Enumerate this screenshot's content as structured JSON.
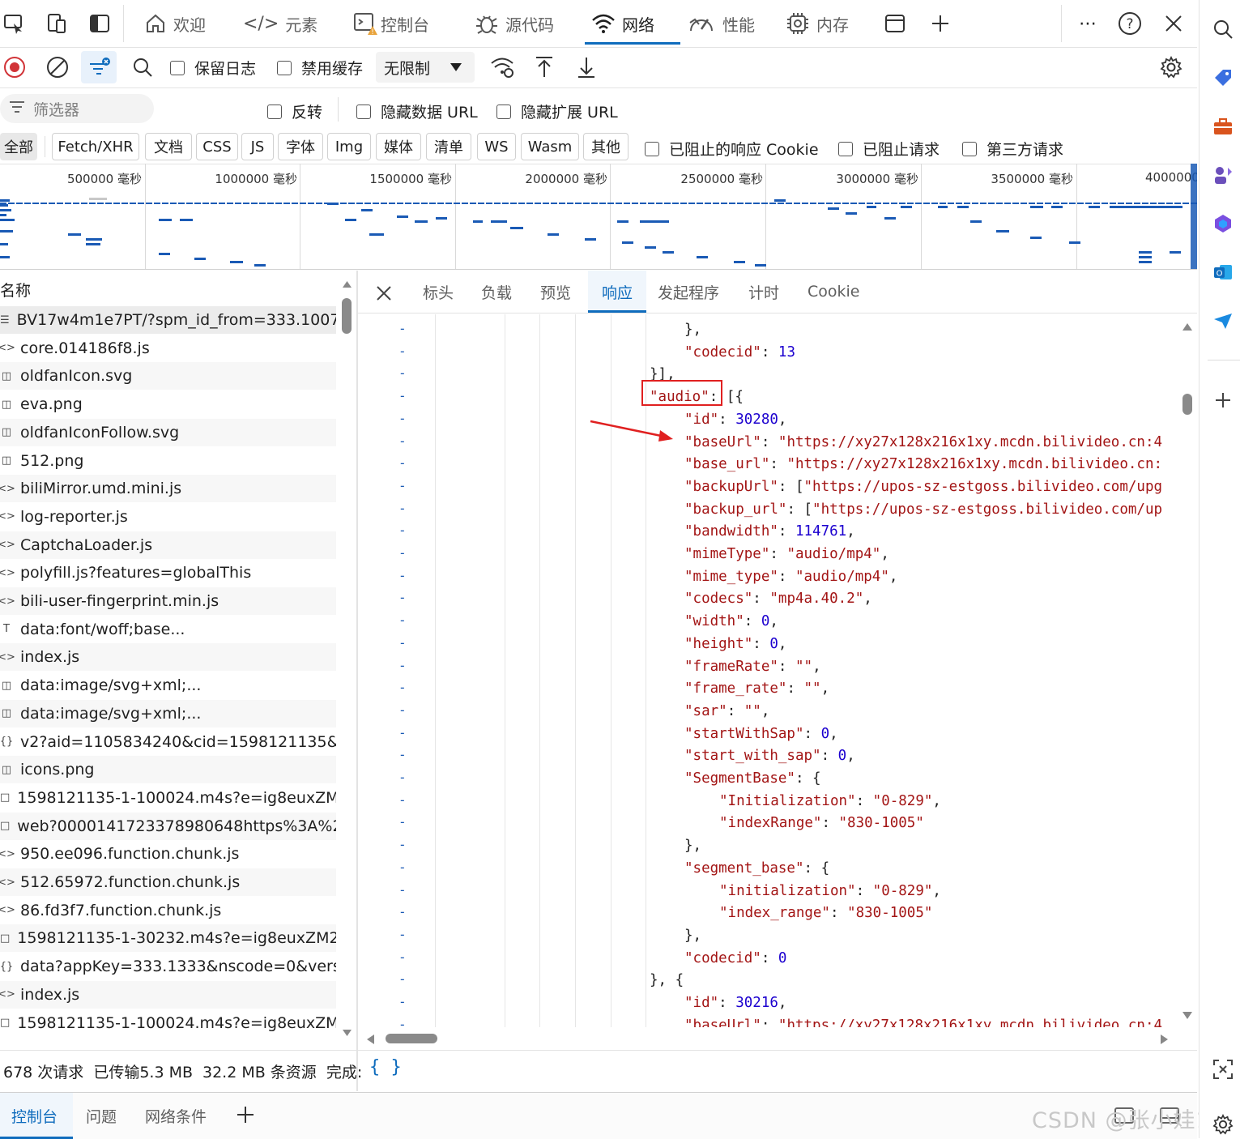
{
  "top_tabs": [
    {
      "label": "欢迎",
      "icon": "home-icon"
    },
    {
      "label": "元素",
      "icon": "code-brackets-icon"
    },
    {
      "label": "控制台",
      "icon": "console-icon"
    },
    {
      "label": "源代码",
      "icon": "bug-icon"
    },
    {
      "label": "网络",
      "icon": "wifi-icon"
    },
    {
      "label": "性能",
      "icon": "performance-icon"
    },
    {
      "label": "内存",
      "icon": "memory-chip-icon"
    }
  ],
  "toolbar": {
    "preserve_log": "保留日志",
    "disable_cache": "禁用缓存",
    "throttling": "无限制"
  },
  "filter": {
    "placeholder": "筛选器",
    "invert": "反转",
    "hide_data_urls": "隐藏数据 URL",
    "hide_ext_urls": "隐藏扩展 URL"
  },
  "type_filters": [
    "全部",
    "Fetch/XHR",
    "文档",
    "CSS",
    "JS",
    "字体",
    "Img",
    "媒体",
    "清单",
    "WS",
    "Wasm",
    "其他"
  ],
  "extra_filters": {
    "blocked_cookies": "已阻止的响应 Cookie",
    "blocked_requests": "已阻止请求",
    "third_party": "第三方请求"
  },
  "overview_ticks": [
    "500000 毫秒",
    "1000000 毫秒",
    "1500000 毫秒",
    "2000000 毫秒",
    "2500000 毫秒",
    "3000000 毫秒",
    "3500000 毫秒",
    "4000000"
  ],
  "list_header": "名称",
  "requests": [
    "BV17w4m1e7PT/?spm_id_from=333.1007....",
    "core.014186f8.js",
    "oldfanIcon.svg",
    "eva.png",
    "oldfanIconFollow.svg",
    "512.png",
    "biliMirror.umd.mini.js",
    "log-reporter.js",
    "CaptchaLoader.js",
    "polyfill.js?features=globalThis",
    "bili-user-fingerprint.min.js",
    "data:font/woff;base...",
    "index.js",
    "data:image/svg+xml;...",
    "data:image/svg+xml;...",
    "v2?aid=1105834240&cid=1598121135&is...",
    "icons.png",
    "1598121135-1-100024.m4s?e=ig8euxZM2...",
    "web?0000141723378980648https%3A%2F...",
    "950.ee096.function.chunk.js",
    "512.65972.function.chunk.js",
    "86.fd3f7.function.chunk.js",
    "1598121135-1-30232.m4s?e=ig8euxZM2r...",
    "data?appKey=333.1333&nscode=0&versi...",
    "index.js",
    "1598121135-1-100024.m4s?e=ig8euxZM2..."
  ],
  "detail_tabs": [
    "标头",
    "负载",
    "预览",
    "响应",
    "发起程序",
    "计时",
    "Cookie"
  ],
  "code_lines": [
    {
      "i": 2,
      "t": [
        [
          "p",
          "},"
        ]
      ]
    },
    {
      "i": 2,
      "t": [
        [
          "k",
          "\"codecid\""
        ],
        [
          "p",
          ": "
        ],
        [
          "n",
          "13"
        ]
      ]
    },
    {
      "i": 0,
      "t": [
        [
          "p",
          "}],"
        ]
      ]
    },
    {
      "i": 0,
      "t": [
        [
          "k",
          "\"audio\""
        ],
        [
          "p",
          ": [{"
        ]
      ]
    },
    {
      "i": 2,
      "t": [
        [
          "k",
          "\"id\""
        ],
        [
          "p",
          ": "
        ],
        [
          "n",
          "30280"
        ],
        [
          "p",
          ","
        ]
      ]
    },
    {
      "i": 2,
      "t": [
        [
          "k",
          "\"baseUrl\""
        ],
        [
          "p",
          ": "
        ],
        [
          "s",
          "\"https://xy27x128x216x1xy.mcdn.bilivideo.cn:4"
        ]
      ]
    },
    {
      "i": 2,
      "t": [
        [
          "k",
          "\"base_url\""
        ],
        [
          "p",
          ": "
        ],
        [
          "s",
          "\"https://xy27x128x216x1xy.mcdn.bilivideo.cn:"
        ]
      ]
    },
    {
      "i": 2,
      "t": [
        [
          "k",
          "\"backupUrl\""
        ],
        [
          "p",
          ": ["
        ],
        [
          "s",
          "\"https://upos-sz-estgoss.bilivideo.com/upg"
        ]
      ]
    },
    {
      "i": 2,
      "t": [
        [
          "k",
          "\"backup_url\""
        ],
        [
          "p",
          ": ["
        ],
        [
          "s",
          "\"https://upos-sz-estgoss.bilivideo.com/up"
        ]
      ]
    },
    {
      "i": 2,
      "t": [
        [
          "k",
          "\"bandwidth\""
        ],
        [
          "p",
          ": "
        ],
        [
          "n",
          "114761"
        ],
        [
          "p",
          ","
        ]
      ]
    },
    {
      "i": 2,
      "t": [
        [
          "k",
          "\"mimeType\""
        ],
        [
          "p",
          ": "
        ],
        [
          "s",
          "\"audio/mp4\""
        ],
        [
          "p",
          ","
        ]
      ]
    },
    {
      "i": 2,
      "t": [
        [
          "k",
          "\"mime_type\""
        ],
        [
          "p",
          ": "
        ],
        [
          "s",
          "\"audio/mp4\""
        ],
        [
          "p",
          ","
        ]
      ]
    },
    {
      "i": 2,
      "t": [
        [
          "k",
          "\"codecs\""
        ],
        [
          "p",
          ": "
        ],
        [
          "s",
          "\"mp4a.40.2\""
        ],
        [
          "p",
          ","
        ]
      ]
    },
    {
      "i": 2,
      "t": [
        [
          "k",
          "\"width\""
        ],
        [
          "p",
          ": "
        ],
        [
          "n",
          "0"
        ],
        [
          "p",
          ","
        ]
      ]
    },
    {
      "i": 2,
      "t": [
        [
          "k",
          "\"height\""
        ],
        [
          "p",
          ": "
        ],
        [
          "n",
          "0"
        ],
        [
          "p",
          ","
        ]
      ]
    },
    {
      "i": 2,
      "t": [
        [
          "k",
          "\"frameRate\""
        ],
        [
          "p",
          ": "
        ],
        [
          "s",
          "\"\""
        ],
        [
          "p",
          ","
        ]
      ]
    },
    {
      "i": 2,
      "t": [
        [
          "k",
          "\"frame_rate\""
        ],
        [
          "p",
          ": "
        ],
        [
          "s",
          "\"\""
        ],
        [
          "p",
          ","
        ]
      ]
    },
    {
      "i": 2,
      "t": [
        [
          "k",
          "\"sar\""
        ],
        [
          "p",
          ": "
        ],
        [
          "s",
          "\"\""
        ],
        [
          "p",
          ","
        ]
      ]
    },
    {
      "i": 2,
      "t": [
        [
          "k",
          "\"startWithSap\""
        ],
        [
          "p",
          ": "
        ],
        [
          "n",
          "0"
        ],
        [
          "p",
          ","
        ]
      ]
    },
    {
      "i": 2,
      "t": [
        [
          "k",
          "\"start_with_sap\""
        ],
        [
          "p",
          ": "
        ],
        [
          "n",
          "0"
        ],
        [
          "p",
          ","
        ]
      ]
    },
    {
      "i": 2,
      "t": [
        [
          "k",
          "\"SegmentBase\""
        ],
        [
          "p",
          ": {"
        ]
      ]
    },
    {
      "i": 4,
      "t": [
        [
          "k",
          "\"Initialization\""
        ],
        [
          "p",
          ": "
        ],
        [
          "s",
          "\"0-829\""
        ],
        [
          "p",
          ","
        ]
      ]
    },
    {
      "i": 4,
      "t": [
        [
          "k",
          "\"indexRange\""
        ],
        [
          "p",
          ": "
        ],
        [
          "s",
          "\"830-1005\""
        ]
      ]
    },
    {
      "i": 2,
      "t": [
        [
          "p",
          "},"
        ]
      ]
    },
    {
      "i": 2,
      "t": [
        [
          "k",
          "\"segment_base\""
        ],
        [
          "p",
          ": {"
        ]
      ]
    },
    {
      "i": 4,
      "t": [
        [
          "k",
          "\"initialization\""
        ],
        [
          "p",
          ": "
        ],
        [
          "s",
          "\"0-829\""
        ],
        [
          "p",
          ","
        ]
      ]
    },
    {
      "i": 4,
      "t": [
        [
          "k",
          "\"index_range\""
        ],
        [
          "p",
          ": "
        ],
        [
          "s",
          "\"830-1005\""
        ]
      ]
    },
    {
      "i": 2,
      "t": [
        [
          "p",
          "},"
        ]
      ]
    },
    {
      "i": 2,
      "t": [
        [
          "k",
          "\"codecid\""
        ],
        [
          "p",
          ": "
        ],
        [
          "n",
          "0"
        ]
      ]
    },
    {
      "i": 0,
      "t": [
        [
          "p",
          "}, {"
        ]
      ]
    },
    {
      "i": 2,
      "t": [
        [
          "k",
          "\"id\""
        ],
        [
          "p",
          ": "
        ],
        [
          "n",
          "30216"
        ],
        [
          "p",
          ","
        ]
      ]
    },
    {
      "i": 2,
      "t": [
        [
          "k",
          "\"baseUrl\""
        ],
        [
          "p",
          ": "
        ],
        [
          "s",
          "\"https://xy27x128x216x1xy.mcdn.bilivideo.cn:4"
        ]
      ]
    }
  ],
  "status": {
    "requests": "678 次请求",
    "transferred": "已传输5.3 MB",
    "resources": "32.2 MB 条资源",
    "finish": "完成:",
    "format_button": "{ }"
  },
  "drawer_tabs": [
    "控制台",
    "问题",
    "网络条件"
  ],
  "watermark": "CSDN @张小娃120",
  "colors": {
    "accent": "#0f6cbd",
    "json_key": "#a31515",
    "json_number": "#1c00cf",
    "highlight_box": "#e02020"
  }
}
